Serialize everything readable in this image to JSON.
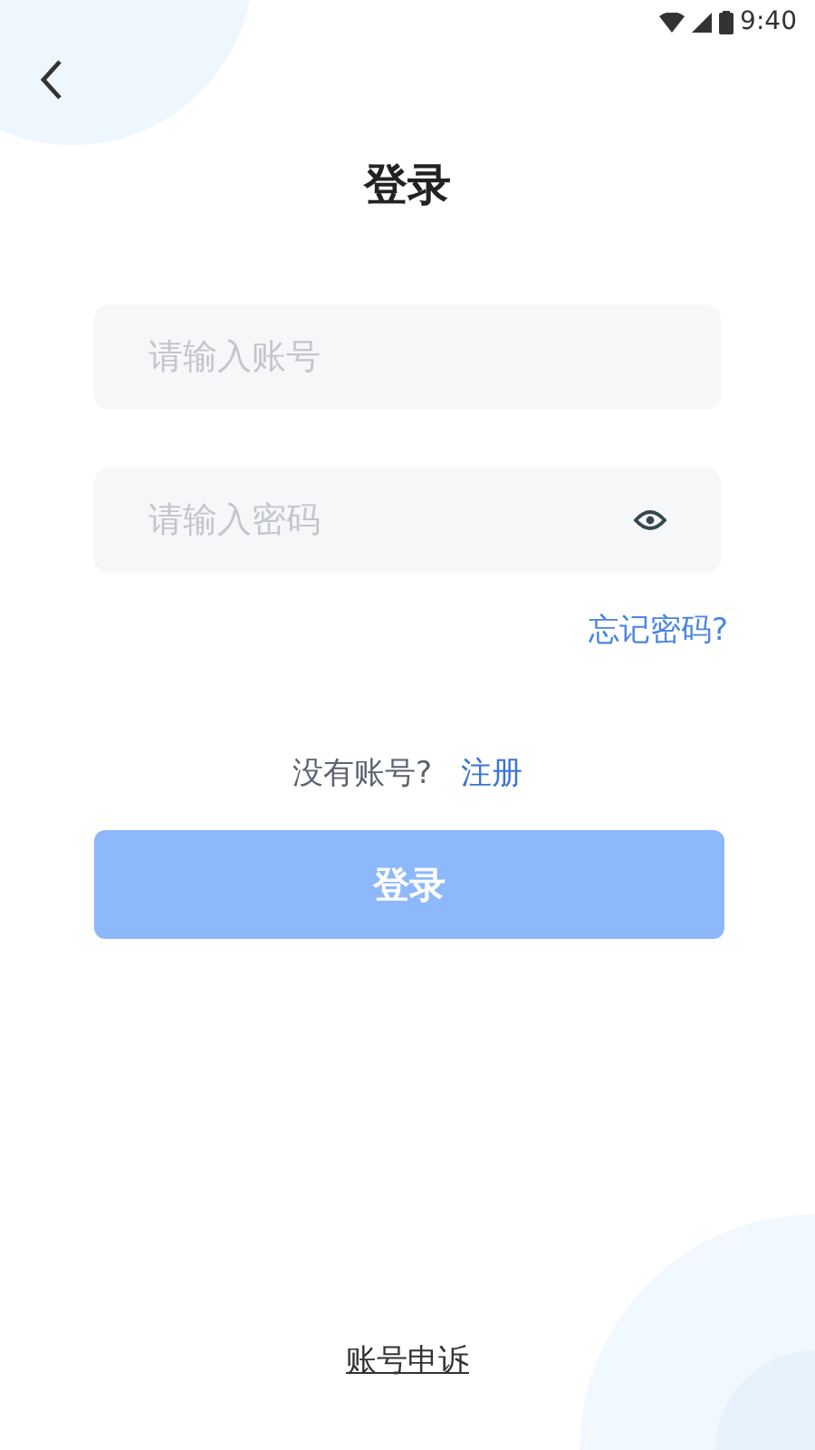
{
  "status_bar": {
    "time": "9:40"
  },
  "title": "登录",
  "fields": [
    {
      "placeholder": "请输入账号",
      "kind": "text"
    },
    {
      "placeholder": "请输入密码",
      "kind": "password"
    }
  ],
  "forgot_link": "忘记密码?",
  "register": {
    "prompt": "没有账号?",
    "link": "注册"
  },
  "login_button": {
    "label": "登录",
    "disabled": true
  },
  "appeal_link": "账号申诉"
}
